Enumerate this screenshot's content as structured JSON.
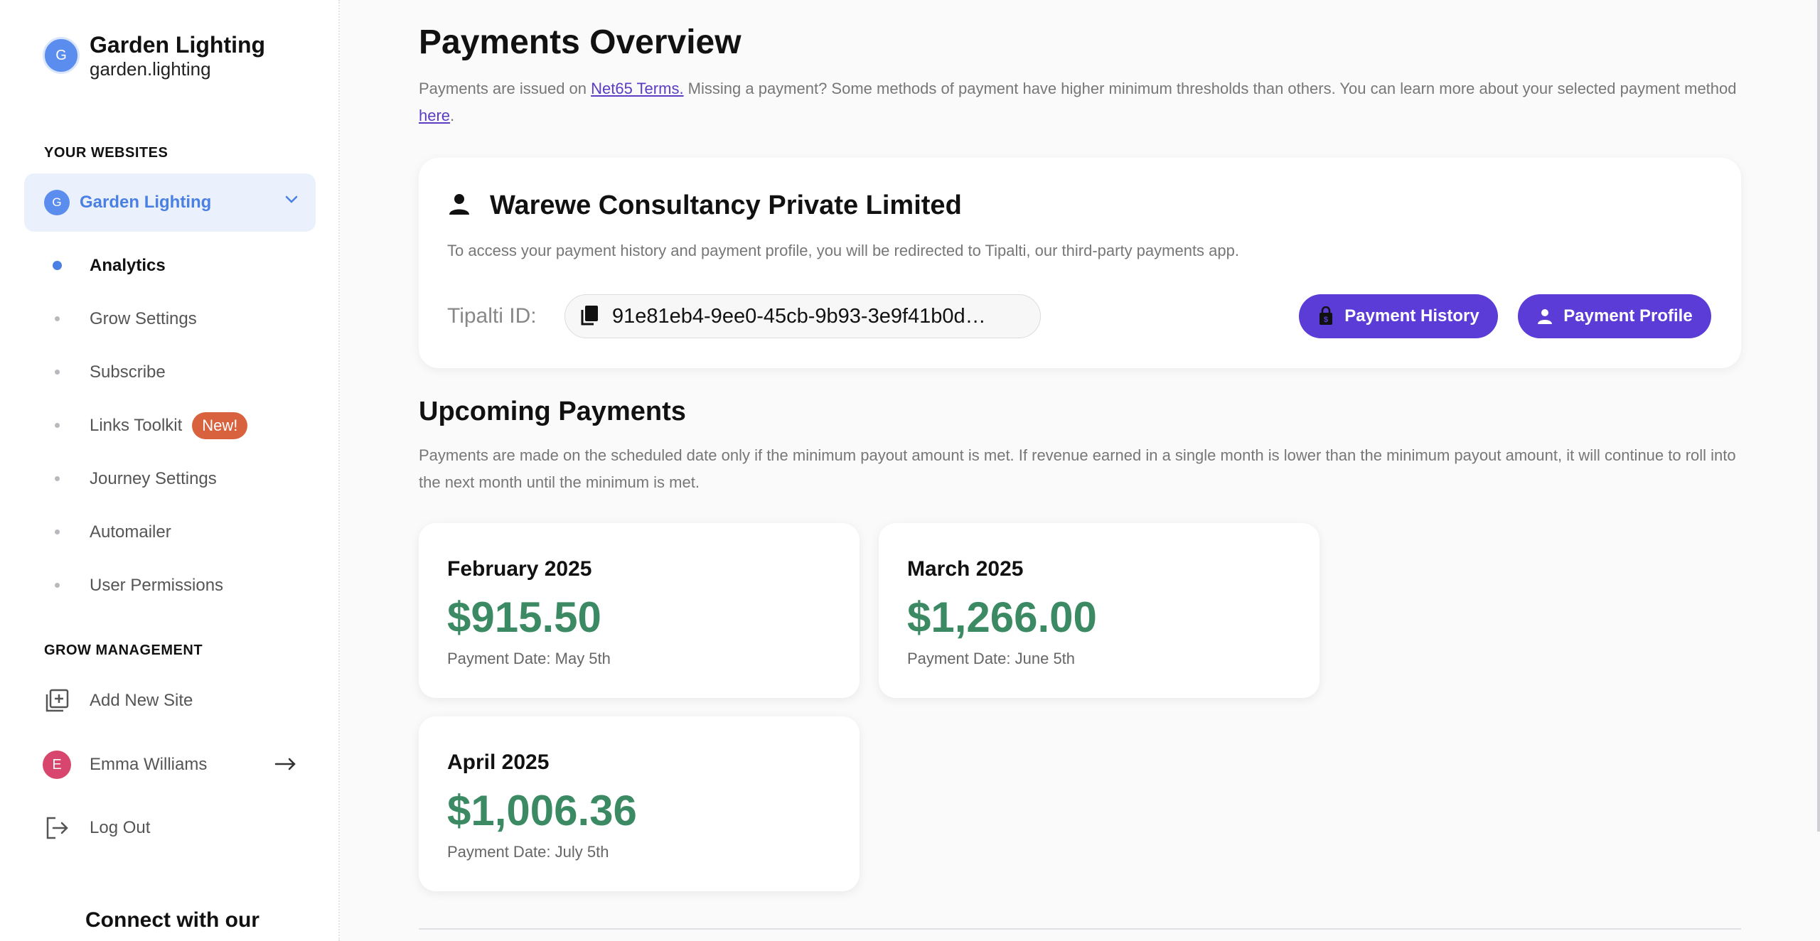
{
  "sidebar": {
    "brand": {
      "avatar_letter": "G",
      "name": "Garden Lighting",
      "domain": "garden.lighting"
    },
    "websites_heading": "YOUR WEBSITES",
    "site_selector": {
      "avatar_letter": "G",
      "label": "Garden Lighting",
      "icon": "chevron-down-icon"
    },
    "nav": [
      {
        "label": "Analytics",
        "active": true
      },
      {
        "label": "Grow Settings"
      },
      {
        "label": "Subscribe"
      },
      {
        "label": "Links Toolkit",
        "badge": "New!"
      },
      {
        "label": "Journey Settings"
      },
      {
        "label": "Automailer"
      },
      {
        "label": "User Permissions"
      }
    ],
    "management_heading": "GROW MANAGEMENT",
    "add_site": {
      "label": "Add New Site",
      "icon": "add-site-icon"
    },
    "user": {
      "avatar_letter": "E",
      "name": "Emma Williams",
      "icon": "arrow-right-icon"
    },
    "logout": {
      "label": "Log Out",
      "icon": "logout-icon"
    },
    "connect_text": "Connect with our"
  },
  "main": {
    "title": "Payments Overview",
    "intro": {
      "before": "Payments are issued on ",
      "link1": "Net65 Terms.",
      "middle": " Missing a payment? Some methods of payment have higher minimum thresholds than others. You can learn more about your selected payment method ",
      "link2": "here",
      "after": "."
    },
    "account": {
      "icon": "person-icon",
      "name": "Warewe Consultancy Private Limited",
      "note": "To access your payment history and payment profile, you will be redirected to Tipalti, our third-party payments app.",
      "tipalti_label": "Tipalti ID:",
      "tipalti_id": "91e81eb4-9ee0-45cb-9b93-3e9f41b0d…",
      "history_button": "Payment History",
      "profile_button": "Payment Profile"
    },
    "upcoming": {
      "title": "Upcoming Payments",
      "description": "Payments are made on the scheduled date only if the minimum payout amount is met. If revenue earned in a single month is lower than the minimum payout amount, it will continue to roll into the next month until the minimum is met.",
      "payments": [
        {
          "month": "February 2025",
          "amount": "$915.50",
          "date": "Payment Date: May 5th"
        },
        {
          "month": "March 2025",
          "amount": "$1,266.00",
          "date": "Payment Date: June 5th"
        },
        {
          "month": "April 2025",
          "amount": "$1,006.36",
          "date": "Payment Date: July 5th"
        }
      ]
    }
  },
  "colors": {
    "accent": "#5b3cd6",
    "sidebar_active": "#4a7fe3",
    "amount": "#3b8a64",
    "badge": "#d8623e"
  }
}
